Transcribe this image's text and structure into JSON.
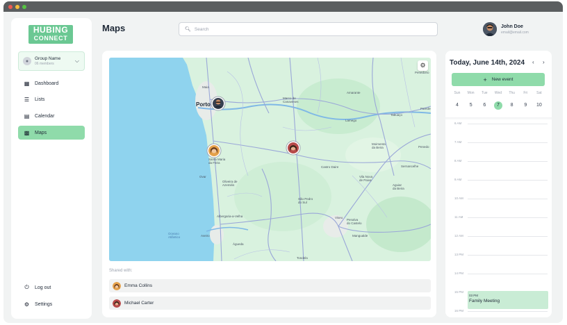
{
  "app": {
    "logo_line1": "HUBING",
    "logo_line2": "CONNECT"
  },
  "group": {
    "name": "Group Name",
    "members": "06 members"
  },
  "nav": [
    {
      "label": "Dashboard",
      "icon": "dashboard-icon"
    },
    {
      "label": "Lists",
      "icon": "list-icon"
    },
    {
      "label": "Calendar",
      "icon": "calendar-icon"
    },
    {
      "label": "Maps",
      "icon": "map-icon",
      "active": true
    }
  ],
  "bottom_nav": [
    {
      "label": "Log out",
      "icon": "power-icon"
    },
    {
      "label": "Settings",
      "icon": "gear-icon"
    }
  ],
  "header": {
    "title": "Maps",
    "search_placeholder": "Search"
  },
  "user": {
    "name": "John Doe",
    "email": "email@email.com"
  },
  "map": {
    "places": [
      "Maia",
      "Porto",
      "Marco de Canaveses",
      "Amarante",
      "Lamego",
      "Tabuaço",
      "Resende",
      "Moimenta da Beira",
      "Sernancelhe",
      "Vila Nova de Paiva",
      "Santa Maria da Feira",
      "Castro Daire",
      "Ovar",
      "Oliveira de Azeméis",
      "São Pedro do Sul",
      "Aguiar da Beira",
      "Oliveira de Frades",
      "Albergaria-a-Velha",
      "Viseu",
      "Penalva do Castelo",
      "Mangualde",
      "Oceano Atlântico",
      "Aveiro",
      "Águeda",
      "Tondela",
      "Penedono",
      "Penedo",
      "Paredes"
    ],
    "colors": {
      "water": "#8fd3ee",
      "land": "#d9f2df",
      "roads": "#9aa7d8"
    }
  },
  "shared": {
    "label": "Shared with:",
    "people": [
      {
        "name": "Emma Collins"
      },
      {
        "name": "Michael Carter"
      }
    ]
  },
  "calendar": {
    "title": "Today, June 14th, 2024",
    "new_event_label": "New event",
    "day_names": [
      "Sun",
      "Mon",
      "Tue",
      "Wed",
      "Thu",
      "Fri",
      "Sat"
    ],
    "dates": [
      "4",
      "5",
      "6",
      "7",
      "8",
      "9",
      "10"
    ],
    "selected_index": 3,
    "times": [
      "6 AM",
      "7 AM",
      "8 AM",
      "9 AM",
      "10 AM",
      "11 AM",
      "12 AM",
      "13 PM",
      "14 PM",
      "15 PM",
      "16 PM"
    ],
    "event": {
      "time": "03 PM",
      "name": "Family Meeting"
    }
  },
  "accent": "#8fdbaa"
}
